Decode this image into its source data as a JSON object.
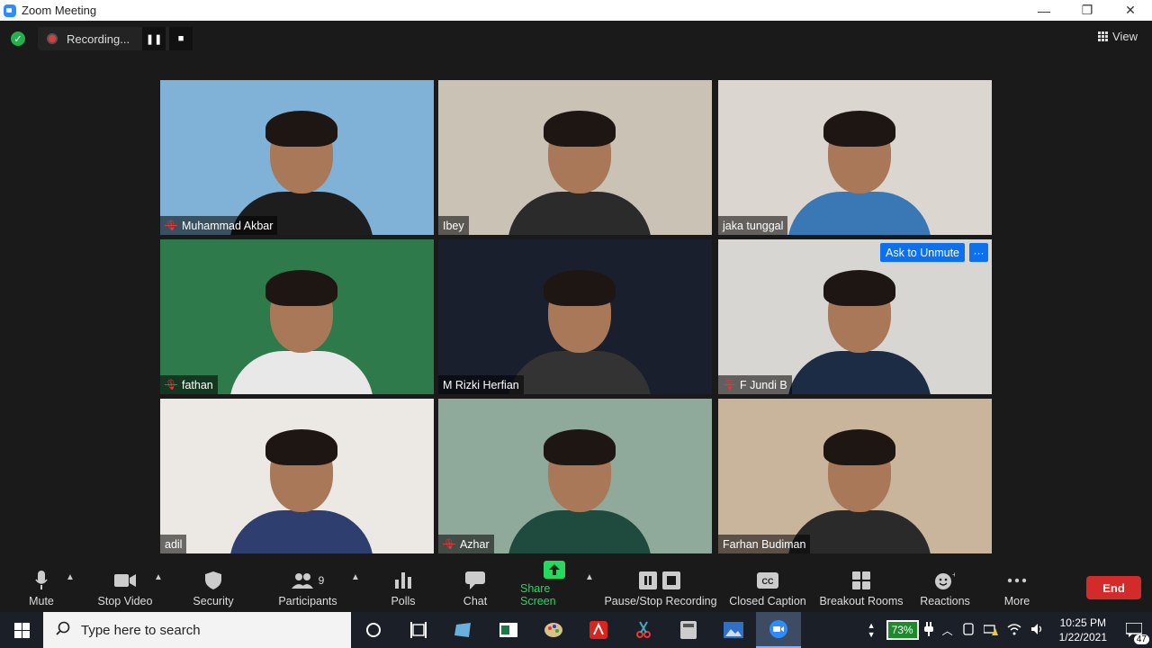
{
  "window": {
    "title": "Zoom Meeting",
    "controls": [
      "—",
      "❐",
      "✕"
    ]
  },
  "meeting": {
    "recording_label": "Recording...",
    "view_label": "View"
  },
  "participants": [
    {
      "name": "Muhammad Akbar",
      "muted": true,
      "bg": "#7fb2d6",
      "shirt": "#1d1d1d"
    },
    {
      "name": "Ibey",
      "muted": false,
      "speaking": true,
      "bg": "#c9c2b5",
      "shirt": "#2b2b2b"
    },
    {
      "name": "jaka tunggal",
      "muted": false,
      "bg": "#dcd6d0",
      "shirt": "#3a78b5"
    },
    {
      "name": "fathan",
      "muted": true,
      "bg": "#2f7a4a",
      "shirt": "#e8e8e8"
    },
    {
      "name": "M Rizki Herfian",
      "muted": false,
      "bg": "#1a1f2e",
      "shirt": "#333"
    },
    {
      "name": "F Jundi B",
      "muted": true,
      "bg": "#d8d6d2",
      "shirt": "#1c2c44",
      "ask_to_unmute": "Ask to Unmute"
    },
    {
      "name": "adil",
      "muted": false,
      "bg": "#ece8e3",
      "shirt": "#2e3e6e"
    },
    {
      "name": "Azhar",
      "muted": true,
      "bg": "#8fa99a",
      "shirt": "#1f4a3e"
    },
    {
      "name": "Farhan Budiman",
      "muted": false,
      "bg": "#c9b49c",
      "shirt": "#2a2a2a"
    }
  ],
  "toolbar": {
    "mute": "Mute",
    "stop_video": "Stop Video",
    "security": "Security",
    "participants": "Participants",
    "participants_count": "9",
    "polls": "Polls",
    "chat": "Chat",
    "share_screen": "Share Screen",
    "pause_stop_recording": "Pause/Stop Recording",
    "closed_caption": "Closed Caption",
    "breakout_rooms": "Breakout Rooms",
    "reactions": "Reactions",
    "more": "More",
    "end": "End"
  },
  "taskbar": {
    "search_placeholder": "Type here to search",
    "battery": "73%",
    "time": "10:25 PM",
    "date": "1/22/2021",
    "notification_count": "47"
  },
  "colors": {
    "active_speaker_border": "#e6e96b",
    "share_green": "#23d95e",
    "end_red": "#d32a2a",
    "ask_blue": "#0e71eb"
  }
}
